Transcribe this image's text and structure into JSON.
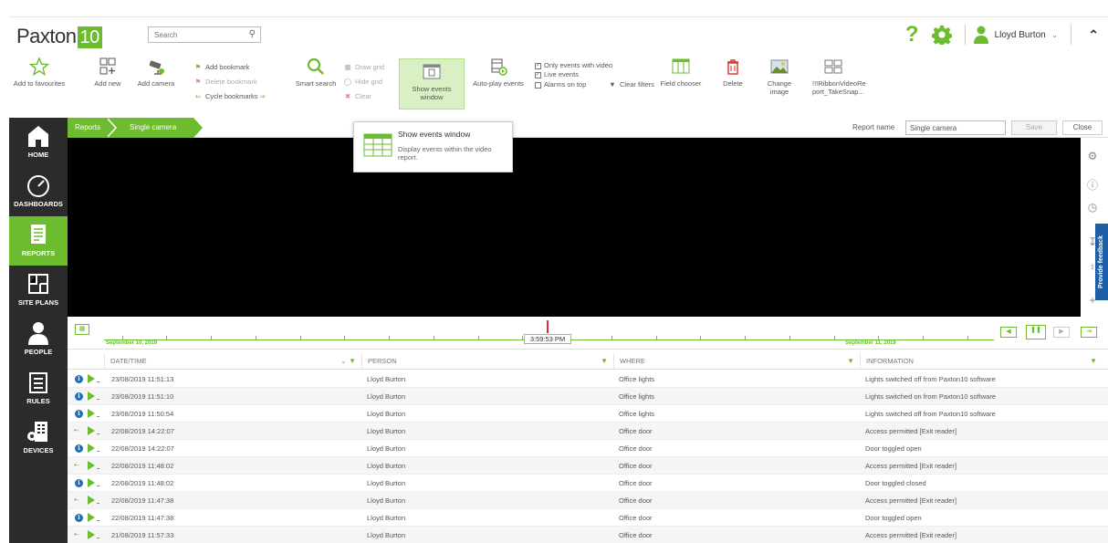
{
  "app": {
    "logo_text": "Paxton",
    "logo_badge": "10",
    "search_placeholder": "Search",
    "user_name": "Lloyd Burton",
    "accent": "#6dbb2f"
  },
  "ribbon": {
    "add_to_favourites": "Add to favourites",
    "add_new": "Add new",
    "add_camera": "Add camera",
    "add_bookmark": "Add bookmark",
    "delete_bookmark": "Delete bookmark",
    "cycle_bookmarks": "Cycle bookmarks",
    "smart_search": "Smart search",
    "draw_grid": "Draw grid",
    "hide_grid": "Hide grid",
    "clear": "Clear",
    "show_events_window_l1": "Show events",
    "show_events_window_l2": "window",
    "auto_play_events": "Auto-play events",
    "only_events_with_video": "Only events with video",
    "live_events": "Live events",
    "alarms_on_top": "Alarms on top",
    "clear_filters": "Clear filters",
    "field_chooser": "Field chooser",
    "delete": "Delete",
    "change_image": "Change image",
    "take_snap_l1": "!!!RibbonVideoRe",
    "take_snap_l2": "port_TakeSnap..."
  },
  "tooltip": {
    "title": "Show events window",
    "description": "Display events within the video report."
  },
  "sidebar": {
    "items": [
      {
        "label": "HOME"
      },
      {
        "label": "DASHBOARDS"
      },
      {
        "label": "REPORTS"
      },
      {
        "label": "SITE PLANS"
      },
      {
        "label": "PEOPLE"
      },
      {
        "label": "RULES"
      },
      {
        "label": "DEVICES"
      }
    ]
  },
  "breadcrumb": {
    "root": "Reports",
    "current": "Single camera"
  },
  "report": {
    "name_label": "Report name",
    "name_value": "Single camera",
    "save_label": "Save",
    "close_label": "Close"
  },
  "feedback": {
    "label": "Provide feedback"
  },
  "timeline": {
    "left_date": "September 10, 2019",
    "right_date": "September 11, 2019",
    "current_time": "3:59:53 PM"
  },
  "table": {
    "headers": {
      "datetime": "DATE/TIME",
      "person": "PERSON",
      "where": "WHERE",
      "information": "INFORMATION"
    },
    "rows": [
      {
        "icon": "info",
        "datetime": "23/08/2019 11:51:13",
        "person": "Lloyd Burton",
        "where": "Office lights",
        "info": "Lights switched off from Paxton10 software"
      },
      {
        "icon": "info",
        "datetime": "23/08/2019 11:51:10",
        "person": "Lloyd Burton",
        "where": "Office lights",
        "info": "Lights switched on from Paxton10 software"
      },
      {
        "icon": "info",
        "datetime": "23/08/2019 11:50:54",
        "person": "Lloyd Burton",
        "where": "Office lights",
        "info": "Lights switched off from Paxton10 software"
      },
      {
        "icon": "key",
        "datetime": "22/08/2019 14:22:07",
        "person": "Lloyd Burton",
        "where": "Office door",
        "info": "Access permitted [Exit reader]"
      },
      {
        "icon": "info",
        "datetime": "22/08/2019 14:22:07",
        "person": "Lloyd Burton",
        "where": "Office door",
        "info": "Door toggled open"
      },
      {
        "icon": "key",
        "datetime": "22/08/2019 11:48:02",
        "person": "Lloyd Burton",
        "where": "Office door",
        "info": "Access permitted [Exit reader]"
      },
      {
        "icon": "info",
        "datetime": "22/08/2019 11:48:02",
        "person": "Lloyd Burton",
        "where": "Office door",
        "info": "Door toggled closed"
      },
      {
        "icon": "key",
        "datetime": "22/08/2019 11:47:38",
        "person": "Lloyd Burton",
        "where": "Office door",
        "info": "Access permitted [Exit reader]"
      },
      {
        "icon": "info",
        "datetime": "22/08/2019 11:47:38",
        "person": "Lloyd Burton",
        "where": "Office door",
        "info": "Door toggled open"
      },
      {
        "icon": "key",
        "datetime": "21/08/2019 11:57:33",
        "person": "Lloyd Burton",
        "where": "Office door",
        "info": "Access permitted [Exit reader]"
      }
    ]
  }
}
